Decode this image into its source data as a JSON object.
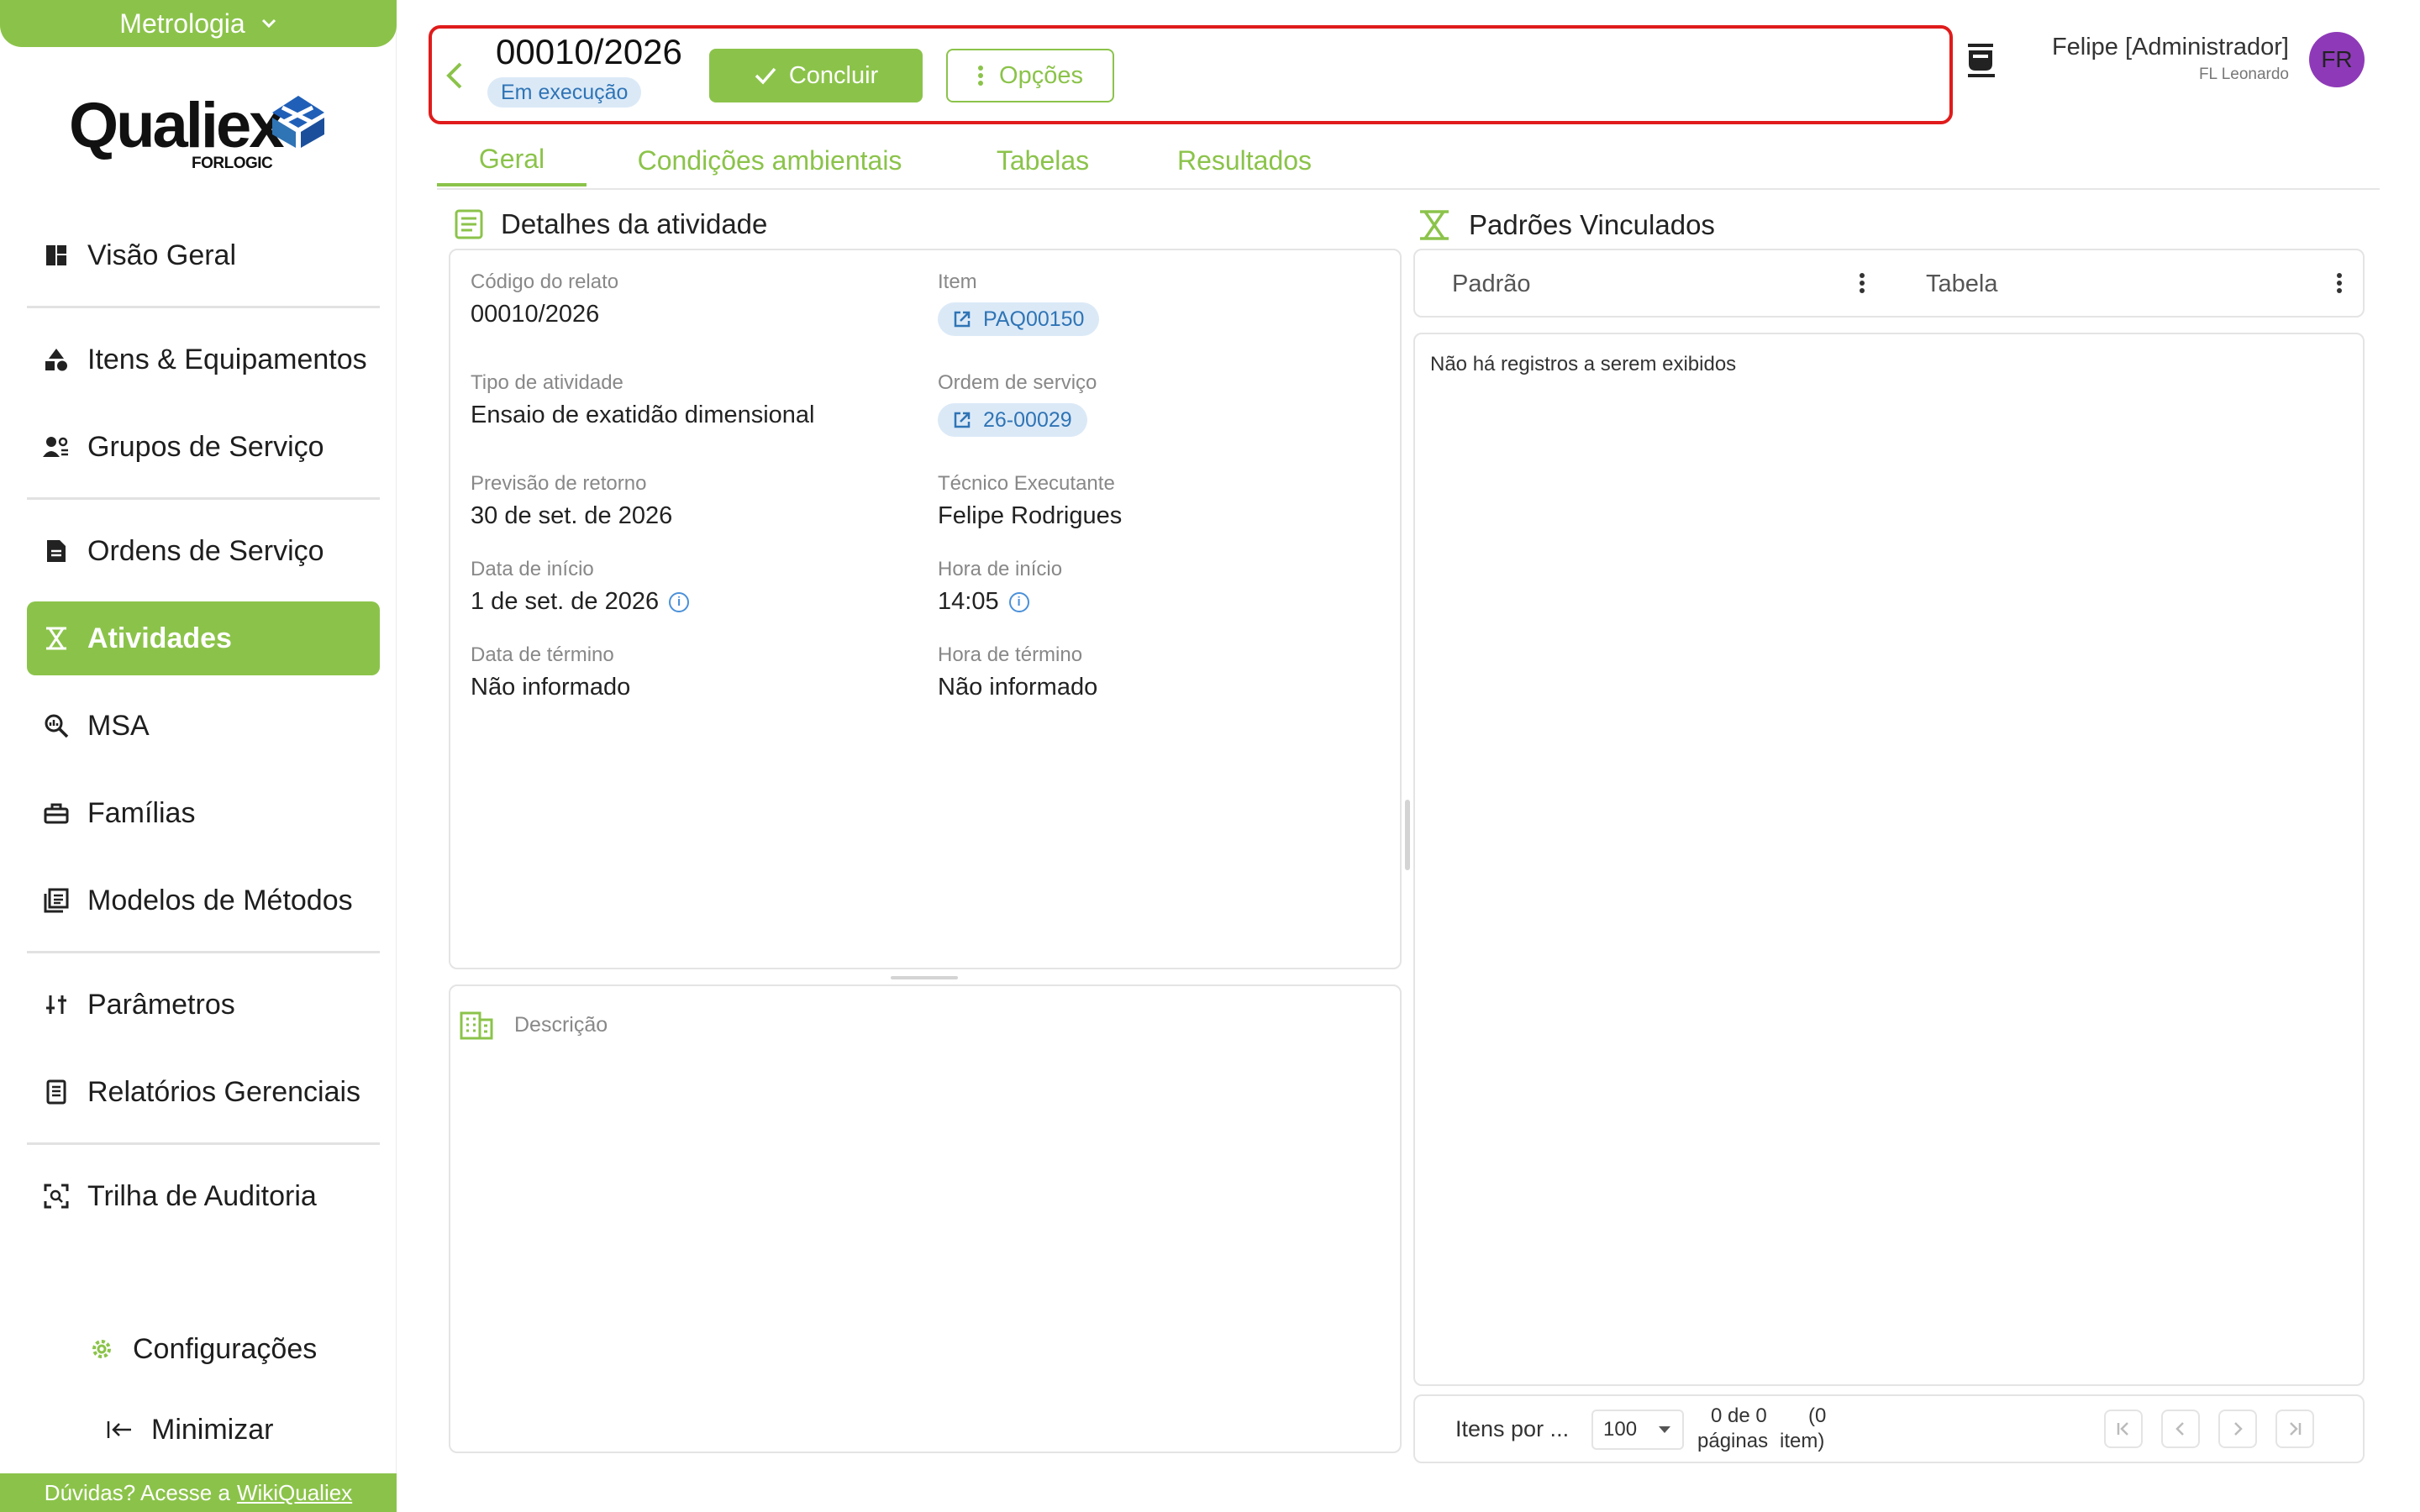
{
  "module": {
    "label": "Metrologia"
  },
  "logo": {
    "brand": "Qualiex",
    "sub": "FORLOGIC"
  },
  "nav": {
    "items": [
      {
        "label": "Visão Geral",
        "icon": "dashboard-icon"
      },
      {
        "label": "Itens & Equipamentos",
        "icon": "shapes-icon"
      },
      {
        "label": "Grupos de Serviço",
        "icon": "user-group-icon"
      },
      {
        "label": "Ordens de Serviço",
        "icon": "document-icon"
      },
      {
        "label": "Atividades",
        "icon": "activity-icon",
        "active": true
      },
      {
        "label": "MSA",
        "icon": "magnify-chart-icon"
      },
      {
        "label": "Famílias",
        "icon": "toolbox-icon"
      },
      {
        "label": "Modelos de Métodos",
        "icon": "library-icon"
      },
      {
        "label": "Parâmetros",
        "icon": "sliders-icon"
      },
      {
        "label": "Relatórios Gerenciais",
        "icon": "report-icon"
      },
      {
        "label": "Trilha de Auditoria",
        "icon": "audit-icon"
      }
    ],
    "settings_label": "Configurações",
    "minimize_label": "Minimizar"
  },
  "help": {
    "text": "Dúvidas? Acesse a",
    "link": "WikiQualiex"
  },
  "header": {
    "code": "00010/2026",
    "status": "Em execução",
    "conclude_label": "Concluir",
    "options_label": "Opções"
  },
  "user": {
    "name": "Felipe [Administrador]",
    "org": "FL Leonardo",
    "initials": "FR"
  },
  "tabs": [
    "Geral",
    "Condições ambientais",
    "Tabelas",
    "Resultados"
  ],
  "details": {
    "title": "Detalhes da atividade",
    "fields": {
      "report_code_label": "Código do relato",
      "report_code": "00010/2026",
      "item_label": "Item",
      "item": "PAQ00150",
      "activity_type_label": "Tipo de atividade",
      "activity_type": "Ensaio de exatidão dimensional",
      "service_order_label": "Ordem de serviço",
      "service_order": "26-00029",
      "return_forecast_label": "Previsão de retorno",
      "return_forecast": "30 de set. de 2026",
      "technician_label": "Técnico Executante",
      "technician": "Felipe Rodrigues",
      "start_date_label": "Data de início",
      "start_date": "1 de set. de 2026",
      "start_time_label": "Hora de início",
      "start_time": "14:05",
      "end_date_label": "Data de término",
      "end_date": "Não informado",
      "end_time_label": "Hora de término",
      "end_time": "Não informado"
    },
    "description_label": "Descrição"
  },
  "standards": {
    "title": "Padrões Vinculados",
    "columns": [
      "Padrão",
      "Tabela"
    ],
    "empty": "Não há registros a serem exibidos",
    "pager": {
      "items_per_label": "Itens por ...",
      "page_size": "100",
      "range": "0 de 0",
      "range_suffix": "(0",
      "pages_label": "páginas",
      "items_label": "item)"
    }
  },
  "colors": {
    "brand": "#8bc34a",
    "accent_blue": "#2f74b5",
    "highlight": "#e01b1b",
    "avatar": "#8e3ab8"
  }
}
